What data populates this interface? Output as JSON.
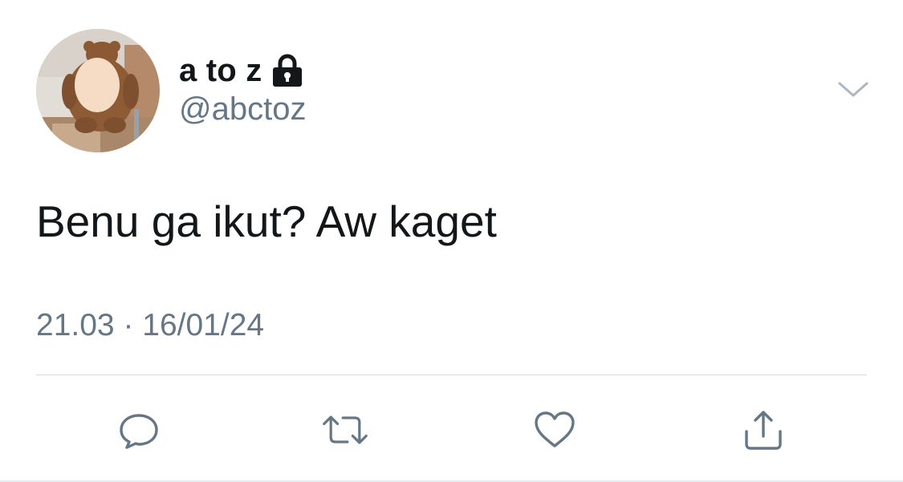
{
  "tweet": {
    "display_name": "a to z",
    "username": "@abctoz",
    "protected": true,
    "text": "Benu ga ikut? Aw kaget",
    "time": "21.03",
    "separator": " · ",
    "date": "16/01/24"
  },
  "icons": {
    "lock": "lock-icon",
    "caret": "chevron-down-icon",
    "reply": "reply-icon",
    "retweet": "retweet-icon",
    "like": "heart-icon",
    "share": "share-icon"
  },
  "colors": {
    "text_primary": "#14171a",
    "text_secondary": "#657786",
    "icon": "#657786",
    "divider": "#d6dbe0"
  }
}
